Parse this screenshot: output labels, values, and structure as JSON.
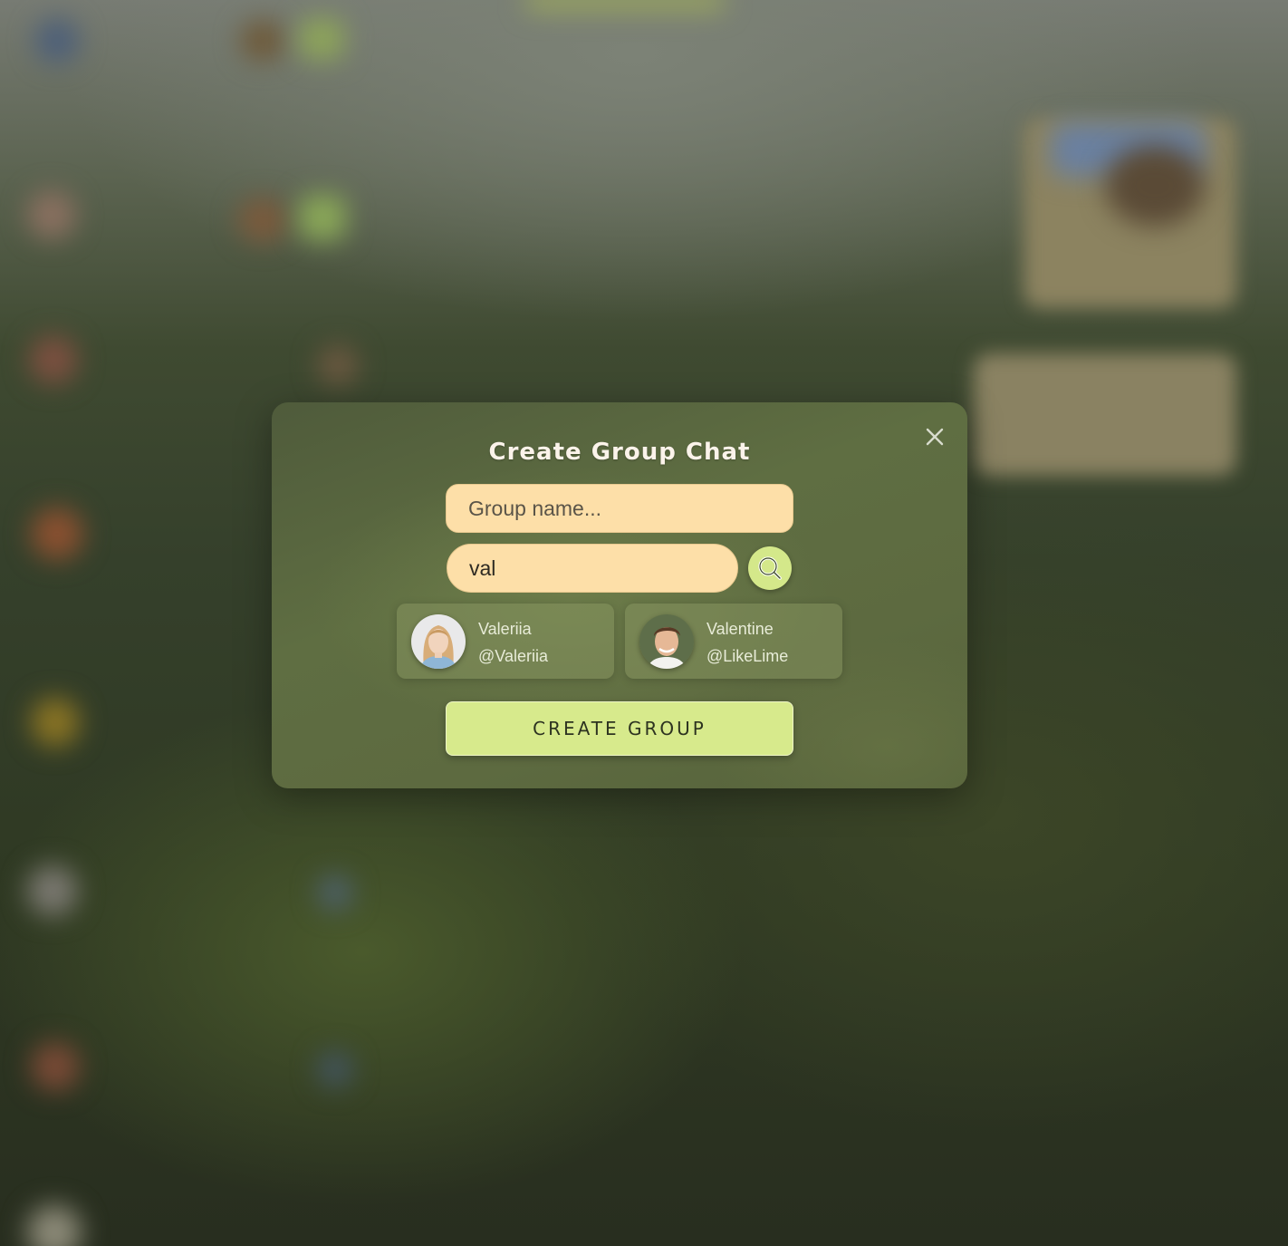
{
  "dialog": {
    "title": "Create Group Chat",
    "close_icon": "close-icon",
    "group_name": {
      "value": "",
      "placeholder": "Group name..."
    },
    "user_search": {
      "value": "val",
      "placeholder": "",
      "search_icon": "search-icon"
    },
    "results": [
      {
        "name": "Valeriia",
        "handle": "@Valeriia"
      },
      {
        "name": "Valentine",
        "handle": "@LikeLime"
      }
    ],
    "create_label": "CREATE GROUP"
  },
  "colors": {
    "input_background": "#fddfa8",
    "accent_button": "#d7ea8c",
    "search_button": "#d4e88a",
    "title_text": "#fbf3ea"
  }
}
